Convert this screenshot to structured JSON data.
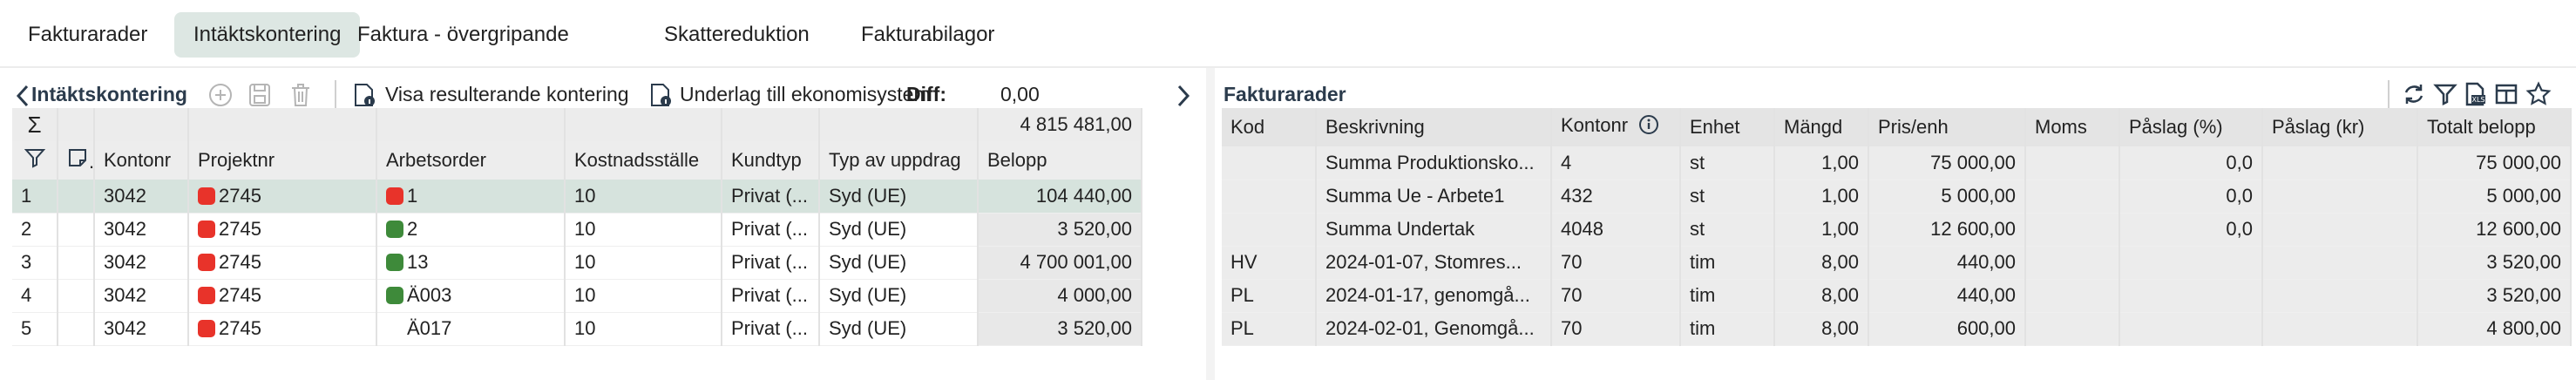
{
  "tabs": [
    "Fakturarader",
    "Intäktskontering",
    "Faktura - övergripande",
    "Skattereduktion",
    "Fakturabilagor"
  ],
  "left": {
    "title": "Intäktskontering",
    "actions": {
      "show_result": "Visa resulterande kontering",
      "basis": "Underlag till ekonomisystem",
      "diff_label": "Diff:",
      "diff_value": "0,00"
    },
    "sum_total": "4 815 481,00",
    "columns": [
      "Kontonr",
      "Projektnr",
      "Arbetsorder",
      "Kostnadsställe",
      "Kundtyp",
      "Typ av uppdrag",
      "Belopp"
    ],
    "rows": [
      {
        "n": "1",
        "kontonr": "3042",
        "projekt": "2745",
        "projekt_color": "#e8332a",
        "ao": "1",
        "ao_color": "#e8332a",
        "kst": "10",
        "kundtyp": "Privat (...",
        "typ": "Syd (UE)",
        "belopp": "104 440,00"
      },
      {
        "n": "2",
        "kontonr": "3042",
        "projekt": "2745",
        "projekt_color": "#e8332a",
        "ao": "2",
        "ao_color": "#3e8a3a",
        "kst": "10",
        "kundtyp": "Privat (...",
        "typ": "Syd (UE)",
        "belopp": "3 520,00"
      },
      {
        "n": "3",
        "kontonr": "3042",
        "projekt": "2745",
        "projekt_color": "#e8332a",
        "ao": "13",
        "ao_color": "#3e8a3a",
        "kst": "10",
        "kundtyp": "Privat (...",
        "typ": "Syd (UE)",
        "belopp": "4 700 001,00"
      },
      {
        "n": "4",
        "kontonr": "3042",
        "projekt": "2745",
        "projekt_color": "#e8332a",
        "ao": "Ä003",
        "ao_color": "#3e8a3a",
        "kst": "10",
        "kundtyp": "Privat (...",
        "typ": "Syd (UE)",
        "belopp": "4 000,00"
      },
      {
        "n": "5",
        "kontonr": "3042",
        "projekt": "2745",
        "projekt_color": "#e8332a",
        "ao": "Ä017",
        "ao_color": "",
        "kst": "10",
        "kundtyp": "Privat (...",
        "typ": "Syd (UE)",
        "belopp": "3 520,00"
      }
    ]
  },
  "right": {
    "title": "Fakturarader",
    "columns": [
      "Kod",
      "Beskrivning",
      "Kontonr",
      "Enhet",
      "Mängd",
      "Pris/enh",
      "Moms",
      "Påslag (%)",
      "Påslag (kr)",
      "Totalt belopp"
    ],
    "rows": [
      {
        "kod": "",
        "besk": "Summa Produktionsko...",
        "konto": "4",
        "enhet": "st",
        "mangd": "1,00",
        "pris": "75 000,00",
        "moms": "",
        "pp": "0,0",
        "pk": "",
        "tot": "75 000,00"
      },
      {
        "kod": "",
        "besk": "Summa Ue - Arbete1",
        "konto": "432",
        "enhet": "st",
        "mangd": "1,00",
        "pris": "5 000,00",
        "moms": "",
        "pp": "0,0",
        "pk": "",
        "tot": "5 000,00"
      },
      {
        "kod": "",
        "besk": "Summa Undertak",
        "konto": "4048",
        "enhet": "st",
        "mangd": "1,00",
        "pris": "12 600,00",
        "moms": "",
        "pp": "0,0",
        "pk": "",
        "tot": "12 600,00"
      },
      {
        "kod": "HV",
        "besk": "2024-01-07, Stomres...",
        "konto": "70",
        "enhet": "tim",
        "mangd": "8,00",
        "pris": "440,00",
        "moms": "",
        "pp": "",
        "pk": "",
        "tot": "3 520,00"
      },
      {
        "kod": "PL",
        "besk": "2024-01-17, genomgå...",
        "konto": "70",
        "enhet": "tim",
        "mangd": "8,00",
        "pris": "440,00",
        "moms": "",
        "pp": "",
        "pk": "",
        "tot": "3 520,00"
      },
      {
        "kod": "PL",
        "besk": "2024-02-01, Genomgå...",
        "konto": "70",
        "enhet": "tim",
        "mangd": "8,00",
        "pris": "600,00",
        "moms": "",
        "pp": "",
        "pk": "",
        "tot": "4 800,00"
      }
    ]
  },
  "colors": {
    "accent_tab": "#dde7e3",
    "selected_row": "#d6e3dd",
    "red": "#e8332a",
    "green": "#3e8a3a"
  }
}
